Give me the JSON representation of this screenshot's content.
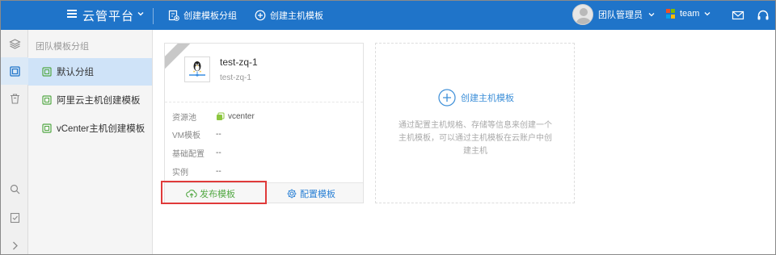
{
  "topbar": {
    "title": "云管平台",
    "actions": [
      {
        "label": "创建模板分组",
        "icon": "folder-add-icon"
      },
      {
        "label": "创建主机模板",
        "icon": "plus-circle-icon"
      }
    ],
    "user_name": "团队管理员",
    "team_name": "team",
    "colors": {
      "bar": "#1f74c9"
    }
  },
  "rail": {
    "items": [
      "layers-icon",
      "template-icon",
      "trash-icon",
      "search-icon",
      "checklist-icon",
      "expand-icon"
    ]
  },
  "sidebar": {
    "title": "团队模板分组",
    "items": [
      {
        "label": "默认分组",
        "active": true
      },
      {
        "label": "阿里云主机创建模板",
        "active": false
      },
      {
        "label": "vCenter主机创建模板",
        "active": false
      }
    ]
  },
  "template_card": {
    "name": "test-zq-1",
    "sub": "test-zq-1",
    "os_icon": "linux-penguin-icon",
    "fields": [
      {
        "key": "资源池",
        "value": "vcenter"
      },
      {
        "key": "VM模板",
        "value": "--"
      },
      {
        "key": "基础配置",
        "value": "--"
      },
      {
        "key": "实例",
        "value": "--"
      }
    ],
    "publish_label": "发布模板",
    "config_label": "配置模板"
  },
  "create_card": {
    "label": "创建主机模板",
    "description": "通过配置主机规格、存储等信息来创建一个主机模板，可以通过主机模板在云账户中创建主机"
  }
}
